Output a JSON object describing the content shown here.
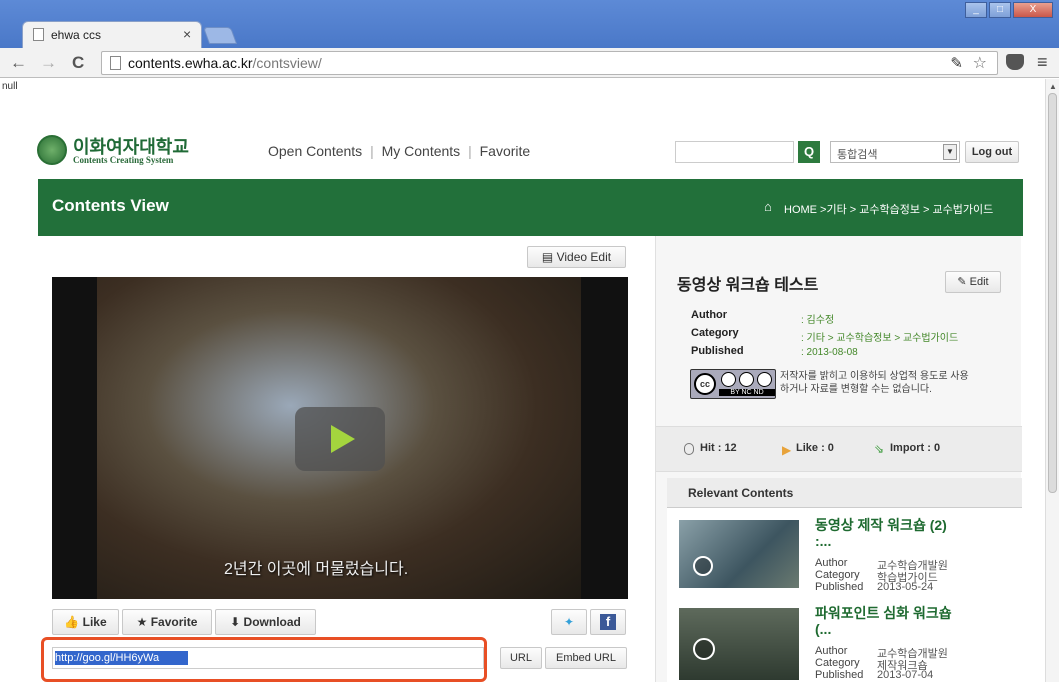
{
  "browser": {
    "tab_title": "ehwa ccs",
    "tab_close": "×",
    "url_host": "contents.ewha.ac.kr",
    "url_path": "/contsview/",
    "nav_back": "←",
    "nav_forward": "→",
    "nav_reload": "C",
    "win_min": "_",
    "win_max": "□",
    "win_close": "X",
    "menu": "≡"
  },
  "page": {
    "null_text": "null",
    "logo_title": "이화여자대학교",
    "logo_sub": "Contents Creating System",
    "nav": [
      {
        "label": "Open Contents"
      },
      {
        "label": "My Contents"
      },
      {
        "label": "Favorite"
      }
    ],
    "search_scope": "통합검색",
    "logout": "Log out",
    "header_title": "Contents View",
    "breadcrumb": "HOME >기타 > 교수학습정보 > 교수법가이드",
    "video_edit": "Video Edit",
    "video_subtitle": "2년간 이곳에 머물렀습니다.",
    "actions": {
      "like": "Like",
      "favorite": "Favorite",
      "download": "Download"
    },
    "share_url": "http://goo.gl/HH6yWa",
    "url_btn": "URL",
    "embed_btn": "Embed URL"
  },
  "content": {
    "title": "동영상 워크숍 테스트",
    "edit": "Edit",
    "author_label": "Author",
    "author": ": 김수정",
    "category_label": "Category",
    "category": ": 기타 > 교수학습정보 > 교수법가이드",
    "published_label": "Published",
    "published": ": 2013-08-08",
    "cc_badge": "BY NC ND",
    "license_line1": "저작자를 밝히고 이용하되 상업적 용도로 사용",
    "license_line2": "하거나 자료를 변형할 수는 없습니다.",
    "hit": "Hit : 12",
    "like": "Like : 0",
    "import": "Import : 0"
  },
  "relevant": {
    "heading": "Relevant Contents",
    "items": [
      {
        "title1": "동영상 제작 워크숍 (2)",
        "title2": ":...",
        "author": "교수학습개발원",
        "category": "학습법가이드",
        "published": "2013-05-24"
      },
      {
        "title1": "파워포인트 심화 워크숍",
        "title2": "(...",
        "author": "교수학습개발원",
        "category": "제작워크숍",
        "published": "2013-07-04"
      }
    ],
    "author_label": "Author",
    "category_label": "Category",
    "published_label": "Published"
  }
}
